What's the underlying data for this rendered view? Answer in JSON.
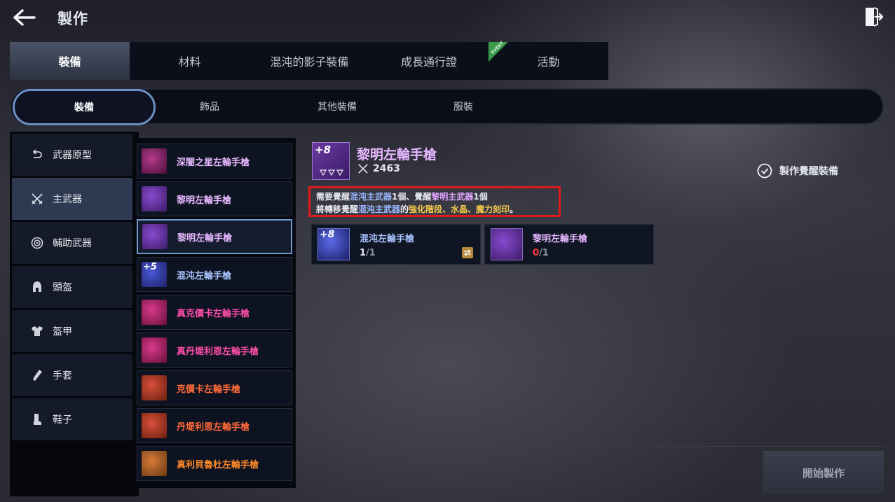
{
  "header": {
    "title": "製作",
    "back_icon": "arrow-left-icon",
    "exit_icon": "exit-door-icon"
  },
  "main_tabs": [
    {
      "label": "裝備",
      "active": true
    },
    {
      "label": "材料"
    },
    {
      "label": "混沌的影子裝備"
    },
    {
      "label": "成長通行證"
    },
    {
      "label": "活動",
      "ribbon": "EVENT"
    }
  ],
  "sub_tabs": [
    {
      "label": "裝備",
      "active": true
    },
    {
      "label": "飾品"
    },
    {
      "label": "其他裝備"
    },
    {
      "label": "服裝"
    }
  ],
  "categories": [
    {
      "label": "武器原型",
      "icon": "weapon-prototype-icon"
    },
    {
      "label": "主武器",
      "icon": "crossed-swords-icon",
      "active": true
    },
    {
      "label": "輔助武器",
      "icon": "orb-icon"
    },
    {
      "label": "頭盔",
      "icon": "helmet-icon"
    },
    {
      "label": "盔甲",
      "icon": "armor-icon"
    },
    {
      "label": "手套",
      "icon": "glove-icon"
    },
    {
      "label": "鞋子",
      "icon": "boot-icon"
    }
  ],
  "items": [
    {
      "name": "深闇之星左輪手槍",
      "color": "#e6b8ff",
      "bg": "#6a1a5a"
    },
    {
      "name": "黎明左輪手槍",
      "color": "#e6b8ff",
      "bg": "#5a2a8a"
    },
    {
      "name": "黎明左輪手槍",
      "color": "#e6b8ff",
      "bg": "#5a2a8a",
      "selected": true
    },
    {
      "name": "混沌左輪手槍",
      "color": "#a8c4ff",
      "bg": "#2a2a8a",
      "badge": "+5"
    },
    {
      "name": "真克價卡左輪手槍",
      "color": "#ff4fa8",
      "bg": "#8a1a5a"
    },
    {
      "name": "真丹堤利恩左輪手槍",
      "color": "#ff4fa8",
      "bg": "#8a1a5a"
    },
    {
      "name": "克價卡左輪手槍",
      "color": "#ff6a3a",
      "bg": "#8a2a1a"
    },
    {
      "name": "丹堤利恩左輪手槍",
      "color": "#ff6a3a",
      "bg": "#8a2a1a"
    },
    {
      "name": "真利貝魯杜左輪手槍",
      "color": "#ff8a2a",
      "bg": "#8a4a1a"
    }
  ],
  "detail": {
    "title": "黎明左輪手槍",
    "thumb_badge": "+8",
    "power": "2463",
    "awaken_option": "製作覺醒裝備",
    "req": {
      "l1a": "需要覺醒",
      "l1b": "混沌主武器",
      "l1c": "1個、覺醒",
      "l1d": "黎明主武器",
      "l1e": "1個",
      "l2a": "將轉移覺醒",
      "l2b": "混沌主武器",
      "l2c": "的",
      "l2d": "強化階段、水晶、魔力刻印",
      "l2e": "。"
    },
    "materials": [
      {
        "name": "混沌左輪手槍",
        "badge": "+8",
        "have": "1",
        "need": "1",
        "color": "#a8c4ff",
        "have_color": "#e6e8ef"
      },
      {
        "name": "黎明左輪手槍",
        "badge": "",
        "have": "0",
        "need": "1",
        "color": "#e6b8ff",
        "have_color": "#ff3a3a"
      }
    ],
    "start_button": "開始製作"
  }
}
